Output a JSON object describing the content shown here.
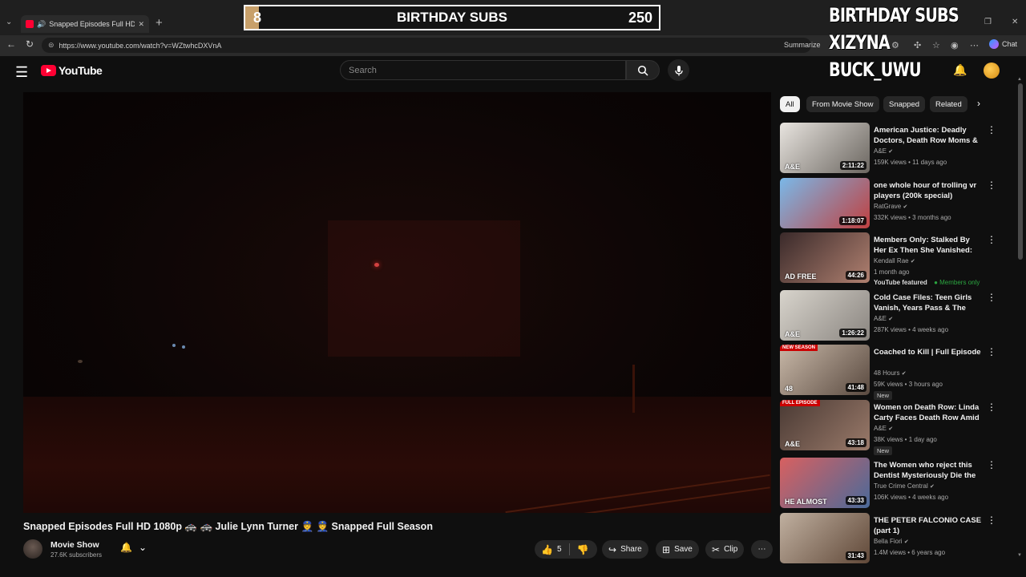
{
  "browser": {
    "tab_title": "Snapped Episodes Full HD 10...",
    "tab_close": "✕",
    "new_tab": "+",
    "url": "https://www.youtube.com/watch?v=WZtwhcDXVnA",
    "summarize": "Summarize",
    "chat": "Chat"
  },
  "overlay": {
    "current": "8",
    "title": "BIRTHDAY SUBS",
    "goal": "250",
    "side_lines": [
      "BIRTHDAY SUBS",
      "XIZYNA",
      "BUCK_UWU"
    ]
  },
  "youtube": {
    "logo_text": "YouTube",
    "search_placeholder": "Search"
  },
  "video": {
    "title": "Snapped Episodes Full HD 1080p 🚓 🚓 Julie Lynn Turner 👮 👮 Snapped Full Season",
    "channel": "Movie Show",
    "subscribers": "27.6K subscribers",
    "likes": "5",
    "share": "Share",
    "save": "Save",
    "clip": "Clip"
  },
  "chips": [
    "All",
    "From Movie Show",
    "Snapped",
    "Related"
  ],
  "recommendations": [
    {
      "title": "American Justice: Deadly Doctors, Death Row Moms & a...",
      "channel": "A&E",
      "verified": true,
      "meta": "159K views • 11 days ago",
      "duration": "2:11:22",
      "badge_top": "",
      "badge_bottom": "A&E",
      "tag": "",
      "colors": [
        "#e8e4df",
        "#6b6660"
      ]
    },
    {
      "title": "one whole hour of trolling vr players (200k special)",
      "channel": "RatGrave",
      "verified": true,
      "meta": "332K views • 3 months ago",
      "duration": "1:18:07",
      "badge_top": "",
      "badge_bottom": "",
      "tag": "",
      "colors": [
        "#7ab8e8",
        "#c04040"
      ]
    },
    {
      "title": "Members Only: Stalked By Her Ex Then She Vanished: Where ...",
      "channel": "Kendall Rae",
      "verified": true,
      "meta": "1 month ago",
      "duration": "44:26",
      "badge_top": "",
      "badge_bottom": "AD FREE",
      "tag": "",
      "featured": "YouTube featured",
      "members": "Members only",
      "colors": [
        "#3a2a2a",
        "#b08070"
      ]
    },
    {
      "title": "Cold Case Files: Teen Girls Vanish, Years Pass & The Kille...",
      "channel": "A&E",
      "verified": true,
      "meta": "287K views • 4 weeks ago",
      "duration": "1:26:22",
      "badge_top": "",
      "badge_bottom": "A&E",
      "tag": "",
      "colors": [
        "#d8d4cc",
        "#8a8580"
      ]
    },
    {
      "title": "Coached to Kill | Full Episode",
      "channel": "48 Hours",
      "verified": true,
      "meta": "59K views • 3 hours ago",
      "duration": "41:48",
      "badge_top": "NEW SEASON",
      "badge_bottom": "48",
      "tag": "New",
      "colors": [
        "#c8b8a8",
        "#5a4a40"
      ]
    },
    {
      "title": "Women on Death Row: Linda Carty Faces Death Row Amid ...",
      "channel": "A&E",
      "verified": true,
      "meta": "38K views • 1 day ago",
      "duration": "43:18",
      "badge_top": "FULL EPISODE",
      "badge_bottom": "A&E",
      "tag": "New",
      "colors": [
        "#4a3a34",
        "#9a7a6a"
      ]
    },
    {
      "title": "The Women who reject this Dentist Mysteriously Die the ...",
      "channel": "True Crime Central",
      "verified": true,
      "meta": "106K views • 4 weeks ago",
      "duration": "43:33",
      "badge_top": "",
      "badge_bottom": "HE ALMOST",
      "tag": "",
      "colors": [
        "#d86060",
        "#4a6a9a"
      ]
    },
    {
      "title": "THE PETER FALCONIO CASE (part 1)",
      "channel": "Bella Fiori",
      "verified": true,
      "meta": "1.4M views • 6 years ago",
      "duration": "31:43",
      "badge_top": "",
      "badge_bottom": "",
      "tag": "",
      "colors": [
        "#c0b0a0",
        "#604838"
      ]
    }
  ]
}
